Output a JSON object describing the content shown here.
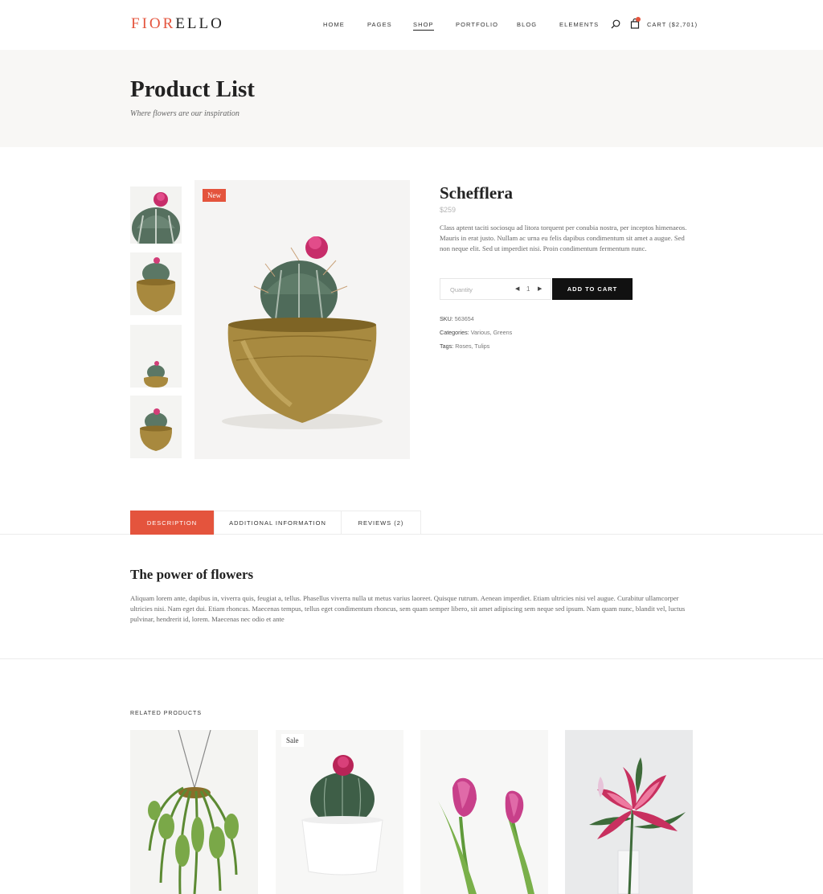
{
  "header": {
    "logo_accent": "FIOR",
    "logo_rest": "ELLO",
    "nav": [
      "HOME",
      "PAGES",
      "SHOP",
      "PORTFOLIO",
      "BLOG",
      "ELEMENTS"
    ],
    "active_nav": "SHOP",
    "cart_label": "CART ($2,701)"
  },
  "title_band": {
    "title": "Product List",
    "subtitle": "Where flowers are our inspiration"
  },
  "gallery": {
    "badge": "New",
    "thumbnails": [
      "cactus-closeup",
      "cactus-pot",
      "cactus-small",
      "cactus-medium"
    ]
  },
  "product": {
    "name": "Schefflera",
    "price": "$259",
    "description": "Class aptent taciti sociosqu ad litora torquent per conubia nostra, per inceptos himenaeos. Mauris in erat justo. Nullam ac urna eu felis dapibus condimentum sit amet a augue. Sed non neque elit. Sed ut imperdiet nisi. Proin condimentum fermentum nunc.",
    "quantity_placeholder": "Quantity",
    "quantity_value": "1",
    "add_to_cart": "ADD TO CART",
    "sku_label": "SKU:",
    "sku_value": "563654",
    "categories_label": "Categories:",
    "categories_value": "Various, Greens",
    "tags_label": "Tags:",
    "tags_value": "Roses, Tulips"
  },
  "tabs": {
    "items": [
      "DESCRIPTION",
      "ADDITIONAL INFORMATION",
      "REVIEWS (2)"
    ],
    "active": "DESCRIPTION"
  },
  "description": {
    "heading": "The power of flowers",
    "text": "Aliquam lorem ante, dapibus in, viverra quis, feugiat a, tellus. Phasellus viverra nulla ut metus varius laoreet. Quisque rutrum. Aenean imperdiet. Etiam ultricies nisi vel augue. Curabitur ullamcorper ultricies nisi. Nam eget dui. Etiam rhoncus. Maecenas tempus, tellus eget condimentum rhoncus, sem quam semper libero, sit amet adipiscing sem neque sed ipsum. Nam quam nunc, blandit vel, luctus pulvinar, hendrerit id, lorem. Maecenas nec odio et ante"
  },
  "related": {
    "title": "RELATED PRODUCTS",
    "sale_badge": "Sale"
  },
  "colors": {
    "accent": "#e4543d",
    "dark": "#111111",
    "band_bg": "#f8f7f5"
  }
}
